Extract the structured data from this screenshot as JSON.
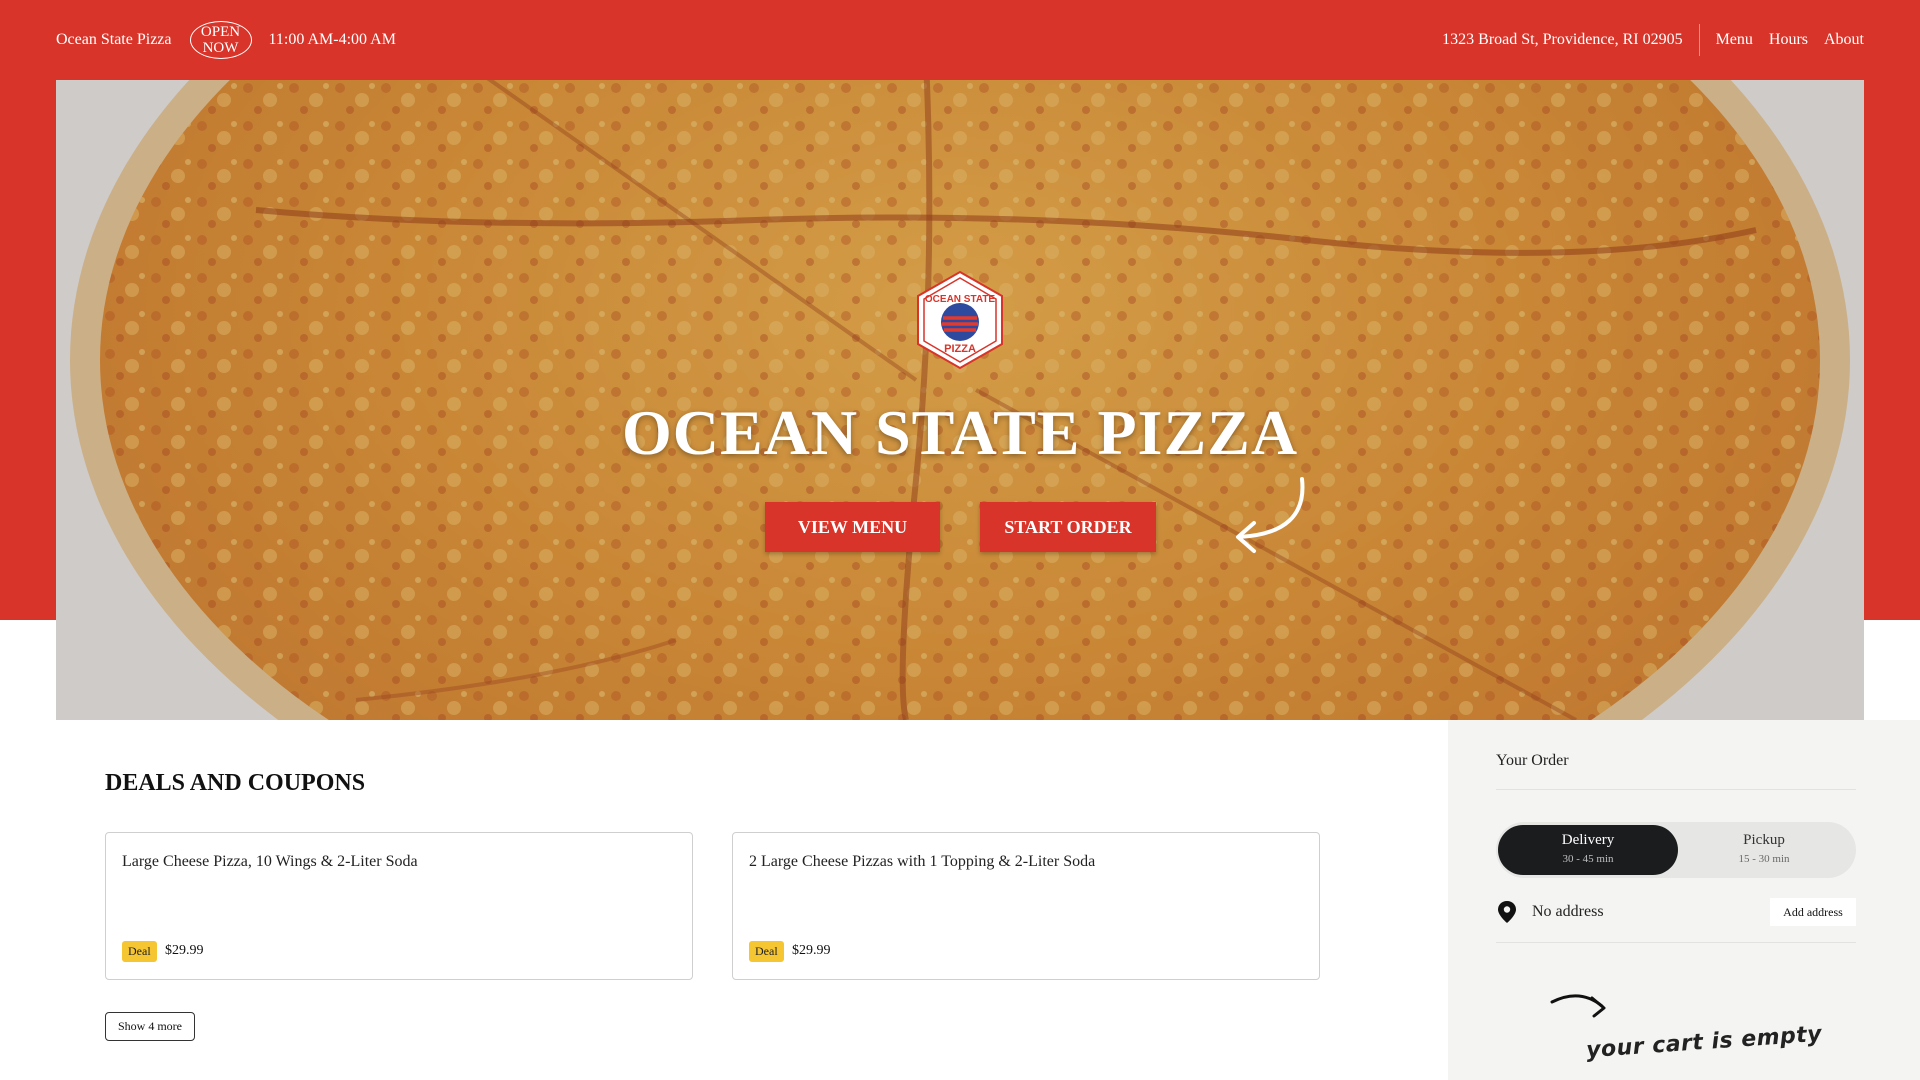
{
  "header": {
    "brand": "Ocean State Pizza",
    "open_status": "OPEN NOW",
    "hours": "11:00 AM-4:00 AM",
    "address": "1323 Broad St, Providence, RI 02905",
    "nav": [
      "Menu",
      "Hours",
      "About"
    ]
  },
  "hero": {
    "title": "OCEAN STATE PIZZA",
    "view_menu_label": "VIEW MENU",
    "start_order_label": "START ORDER",
    "logo_text_top": "OCEAN STATE",
    "logo_text_bottom": "PIZZA"
  },
  "deals": {
    "title": "DEALS AND COUPONS",
    "items": [
      {
        "name": "Large Cheese Pizza, 10 Wings & 2-Liter Soda",
        "tag": "Deal",
        "price": "$29.99"
      },
      {
        "name": "2 Large Cheese Pizzas with 1 Topping & 2-Liter Soda",
        "tag": "Deal",
        "price": "$29.99"
      }
    ],
    "show_more_label": "Show 4 more"
  },
  "order": {
    "title": "Your Order",
    "delivery": {
      "label": "Delivery",
      "time": "30 - 45 min"
    },
    "pickup": {
      "label": "Pickup",
      "time": "15 - 30 min"
    },
    "address_text": "No address",
    "add_address_label": "Add address",
    "empty_text": "your cart is empty"
  },
  "colors": {
    "brand_red": "#d8342a",
    "deal_tag": "#f6c532",
    "toggle_active": "#1b1c1e",
    "panel_bg": "#f4f4f2"
  },
  "icons": [
    "location-pin-icon",
    "curved-arrow-icon",
    "logo-badge"
  ]
}
